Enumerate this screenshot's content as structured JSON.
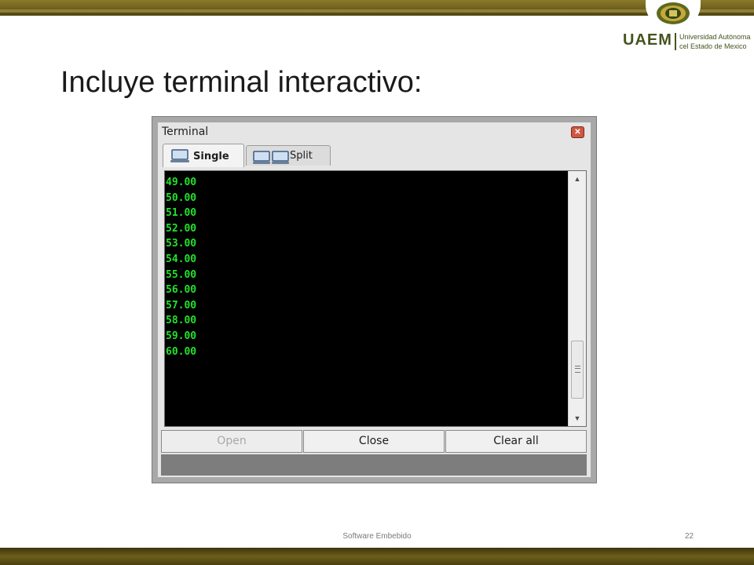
{
  "slide": {
    "title": "Incluye terminal interactivo:",
    "footer": "Software Embebido",
    "page_number": "22"
  },
  "logo": {
    "acronym": "UAEM",
    "line1": "Universidad Autónoma",
    "line2": "cel Estado de Mexico"
  },
  "window": {
    "title": "Terminal",
    "close_glyph": "✕",
    "tabs": [
      {
        "label": "Single",
        "icon": "monitor-icon",
        "active": true
      },
      {
        "label": "Split",
        "icon": "dual-monitor-icon",
        "active": false
      }
    ],
    "output_lines": [
      "49.00",
      "50.00",
      "51.00",
      "52.00",
      "53.00",
      "54.00",
      "55.00",
      "56.00",
      "57.00",
      "58.00",
      "59.00",
      "60.00"
    ],
    "scroll_position": 0.93,
    "buttons": {
      "open": "Open",
      "close": "Close",
      "clear": "Clear all"
    },
    "open_enabled": false
  },
  "colors": {
    "output_text": "#22e22a",
    "console_bg": "#000000",
    "band": "#6b5d1a",
    "logo": "#46541f"
  }
}
